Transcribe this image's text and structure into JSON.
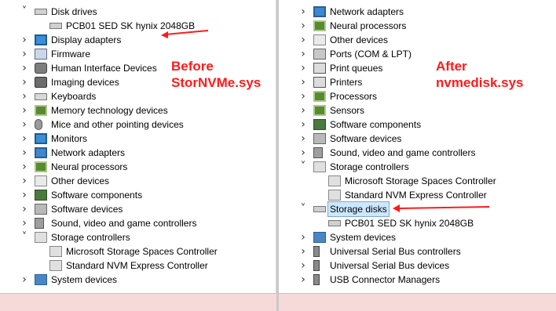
{
  "left": {
    "items": [
      {
        "label": "Disk drives",
        "icon": "disk-drive-icon",
        "chevron": "expanded"
      },
      {
        "label": "PCB01 SED SK hynix 2048GB",
        "icon": "disk-drive-icon",
        "chevron": "none"
      },
      {
        "label": "Display adapters",
        "icon": "display-adapter-icon",
        "chevron": "collapsed"
      },
      {
        "label": "Firmware",
        "icon": "firmware-icon",
        "chevron": "collapsed"
      },
      {
        "label": "Human Interface Devices",
        "icon": "hid-icon",
        "chevron": "collapsed"
      },
      {
        "label": "Imaging devices",
        "icon": "camera-icon",
        "chevron": "collapsed"
      },
      {
        "label": "Keyboards",
        "icon": "keyboard-icon",
        "chevron": "collapsed"
      },
      {
        "label": "Memory technology devices",
        "icon": "memory-chip-icon",
        "chevron": "collapsed"
      },
      {
        "label": "Mice and other pointing devices",
        "icon": "mouse-icon",
        "chevron": "collapsed"
      },
      {
        "label": "Monitors",
        "icon": "monitor-icon",
        "chevron": "collapsed"
      },
      {
        "label": "Network adapters",
        "icon": "network-adapter-icon",
        "chevron": "collapsed"
      },
      {
        "label": "Neural processors",
        "icon": "processor-chip-icon",
        "chevron": "collapsed"
      },
      {
        "label": "Other devices",
        "icon": "unknown-device-icon",
        "chevron": "collapsed"
      },
      {
        "label": "Software components",
        "icon": "puzzle-icon",
        "chevron": "collapsed"
      },
      {
        "label": "Software devices",
        "icon": "software-device-icon",
        "chevron": "collapsed"
      },
      {
        "label": "Sound, video and game controllers",
        "icon": "speaker-icon",
        "chevron": "collapsed"
      },
      {
        "label": "Storage controllers",
        "icon": "storage-controller-icon",
        "chevron": "expanded"
      },
      {
        "label": "Microsoft Storage Spaces Controller",
        "icon": "storage-controller-icon",
        "chevron": "none"
      },
      {
        "label": "Standard NVM Express Controller",
        "icon": "storage-controller-icon",
        "chevron": "none"
      },
      {
        "label": "System devices",
        "icon": "system-device-icon",
        "chevron": "collapsed"
      }
    ],
    "annotation": {
      "line1": "Before",
      "line2": "StorNVMe.sys"
    }
  },
  "right": {
    "items": [
      {
        "label": "Network adapters",
        "icon": "network-adapter-icon",
        "chevron": "collapsed"
      },
      {
        "label": "Neural processors",
        "icon": "processor-chip-icon",
        "chevron": "collapsed"
      },
      {
        "label": "Other devices",
        "icon": "unknown-device-icon",
        "chevron": "collapsed"
      },
      {
        "label": "Ports (COM & LPT)",
        "icon": "port-icon",
        "chevron": "collapsed"
      },
      {
        "label": "Print queues",
        "icon": "printer-icon",
        "chevron": "collapsed"
      },
      {
        "label": "Printers",
        "icon": "printer-icon",
        "chevron": "collapsed"
      },
      {
        "label": "Processors",
        "icon": "processor-chip-icon",
        "chevron": "collapsed"
      },
      {
        "label": "Sensors",
        "icon": "sensor-icon",
        "chevron": "collapsed"
      },
      {
        "label": "Software components",
        "icon": "puzzle-icon",
        "chevron": "collapsed"
      },
      {
        "label": "Software devices",
        "icon": "software-device-icon",
        "chevron": "collapsed"
      },
      {
        "label": "Sound, video and game controllers",
        "icon": "speaker-icon",
        "chevron": "collapsed"
      },
      {
        "label": "Storage controllers",
        "icon": "storage-controller-icon",
        "chevron": "expanded"
      },
      {
        "label": "Microsoft Storage Spaces Controller",
        "icon": "storage-controller-icon",
        "chevron": "none"
      },
      {
        "label": "Standard NVM Express Controller",
        "icon": "storage-controller-icon",
        "chevron": "none"
      },
      {
        "label": "Storage disks",
        "icon": "disk-drive-icon",
        "chevron": "expanded",
        "selected": true
      },
      {
        "label": "PCB01 SED SK hynix 2048GB",
        "icon": "disk-drive-icon",
        "chevron": "none"
      },
      {
        "label": "System devices",
        "icon": "system-device-icon",
        "chevron": "collapsed"
      },
      {
        "label": "Universal Serial Bus controllers",
        "icon": "usb-icon",
        "chevron": "collapsed"
      },
      {
        "label": "Universal Serial Bus devices",
        "icon": "usb-icon",
        "chevron": "collapsed"
      },
      {
        "label": "USB Connector Managers",
        "icon": "usb-icon",
        "chevron": "collapsed"
      }
    ],
    "annotation": {
      "line1": "After",
      "line2": "nvmedisk.sys"
    }
  },
  "colors": {
    "annotation": "#ff1a1a",
    "selection": "#cce8ff",
    "bottom_strip": "#f6dada"
  }
}
